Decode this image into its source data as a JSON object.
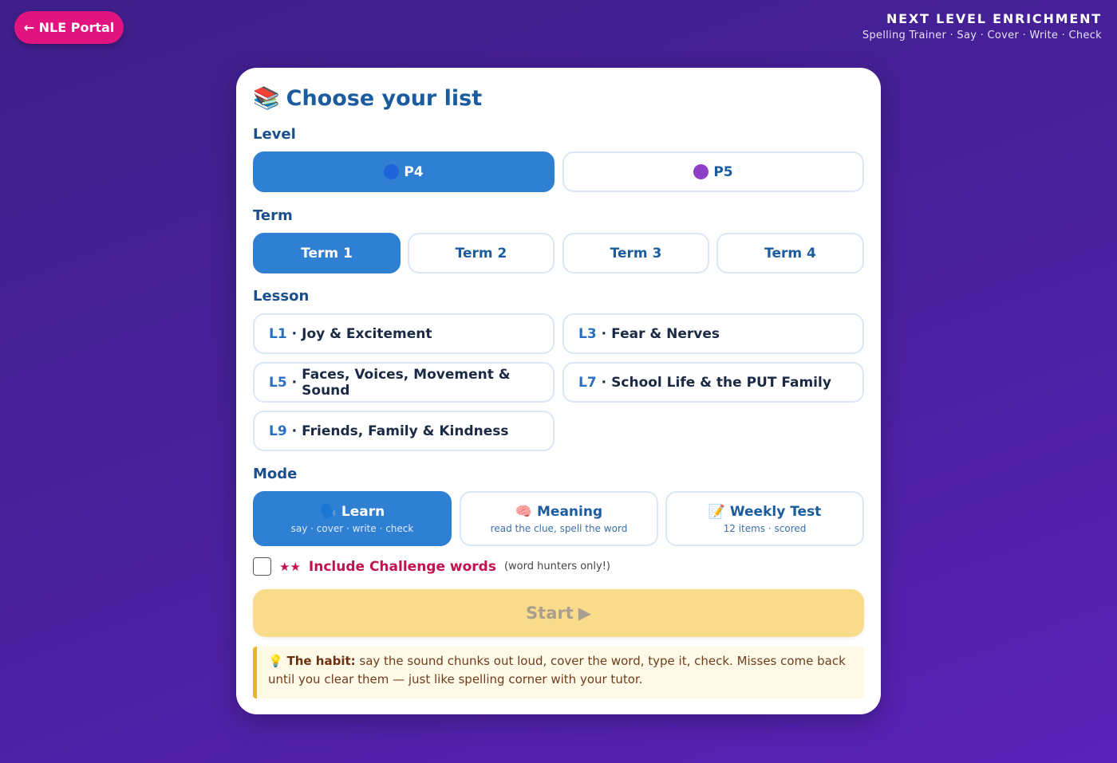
{
  "header": {
    "portal_label": "← NLE Portal",
    "brand_title": "NEXT LEVEL ENRICHMENT",
    "brand_subtitle": "Spelling Trainer · Say · Cover · Write · Check"
  },
  "card": {
    "title": "Choose your list",
    "title_icon": "📚"
  },
  "level": {
    "label": "Level",
    "options": [
      {
        "label": "P4",
        "dot_color": "#1e63d8",
        "active": true
      },
      {
        "label": "P5",
        "dot_color": "#8e3fc8",
        "active": false
      }
    ]
  },
  "term": {
    "label": "Term",
    "options": [
      {
        "label": "Term 1",
        "active": true
      },
      {
        "label": "Term 2",
        "active": false
      },
      {
        "label": "Term 3",
        "active": false
      },
      {
        "label": "Term 4",
        "active": false
      }
    ]
  },
  "lesson": {
    "label": "Lesson",
    "items": [
      {
        "code": "L1",
        "sep": "·",
        "title": "Joy & Excitement"
      },
      {
        "code": "L3",
        "sep": "·",
        "title": "Fear & Nerves"
      },
      {
        "code": "L5",
        "sep": "·",
        "title": "Faces, Voices, Movement & Sound"
      },
      {
        "code": "L7",
        "sep": "·",
        "title": "School Life & the PUT Family"
      },
      {
        "code": "L9",
        "sep": "·",
        "title": "Friends, Family & Kindness"
      }
    ]
  },
  "mode": {
    "label": "Mode",
    "options": [
      {
        "icon": "🗣️",
        "title": "Learn",
        "subtitle": "say · cover · write · check",
        "active": true
      },
      {
        "icon": "🧠",
        "title": "Meaning",
        "subtitle": "read the clue, spell the word",
        "active": false
      },
      {
        "icon": "📝",
        "title": "Weekly Test",
        "subtitle": "12 items · scored",
        "active": false
      }
    ]
  },
  "challenge": {
    "stars": "★★",
    "label": "Include Challenge words",
    "note": "(word hunters only!)",
    "checked": false
  },
  "start": {
    "label": "Start",
    "icon": "▶"
  },
  "tip": {
    "icon": "💡",
    "bold": "The habit:",
    "text": " say the sound chunks out loud, cover the word, type it, check. Misses come back until you clear them — just like spelling corner with your tutor."
  },
  "colors": {
    "accent": "#2f7fd3",
    "portal": "#e0137f",
    "challenge": "#c3124e",
    "start_bg": "#f8dc8c",
    "tip_border": "#eab528"
  }
}
